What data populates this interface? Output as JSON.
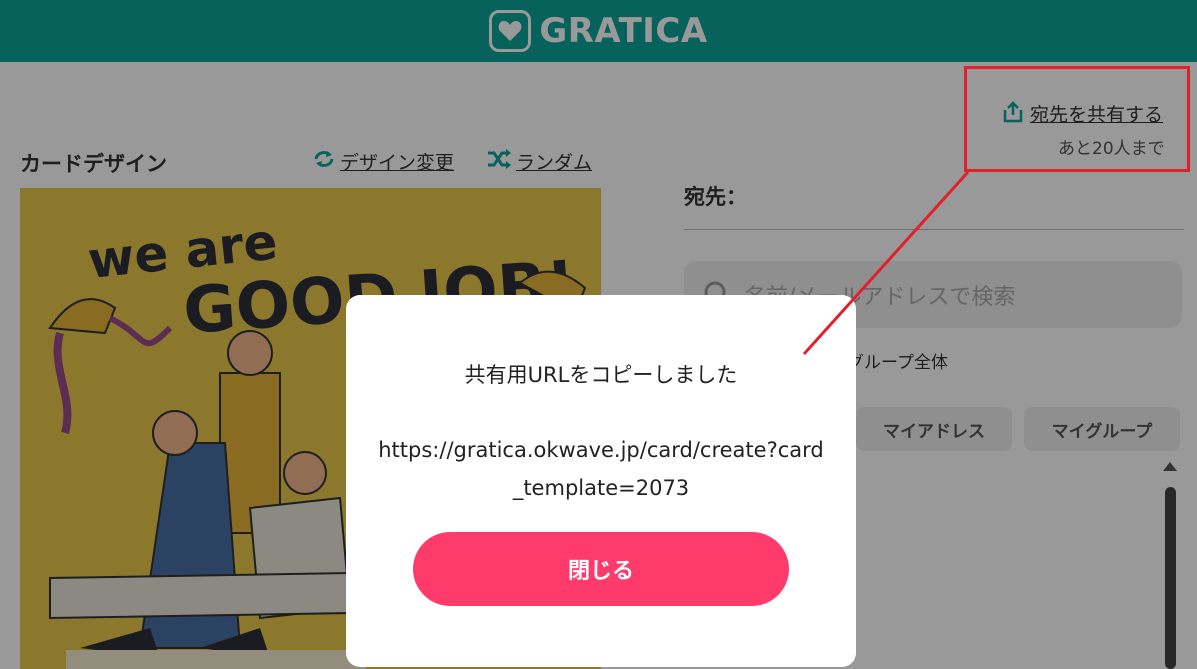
{
  "header": {
    "brand": "GRATICA",
    "brand_color": "#0aa398"
  },
  "share": {
    "label": "宛先を共有する",
    "note": "あと20人まで",
    "icon": "share-icon"
  },
  "card": {
    "section_title": "カードデザイン",
    "change_design_label": "デザイン変更",
    "random_label": "ランダム",
    "image_alt": "we are GOOD JOB!"
  },
  "recipients": {
    "label": "宛先：",
    "search_placeholder": "名前/メールアドレスで検索",
    "group_all": "グループ全体",
    "tabs": [
      "マイアドレス",
      "マイグループ"
    ]
  },
  "modal": {
    "title": "共有用URLをコピーしました",
    "url": "https://gratica.okwave.jp/card/create?card_template=2073",
    "close_label": "閉じる",
    "close_color": "#ff3b6c"
  },
  "annotation": {
    "color": "#e0202a"
  }
}
